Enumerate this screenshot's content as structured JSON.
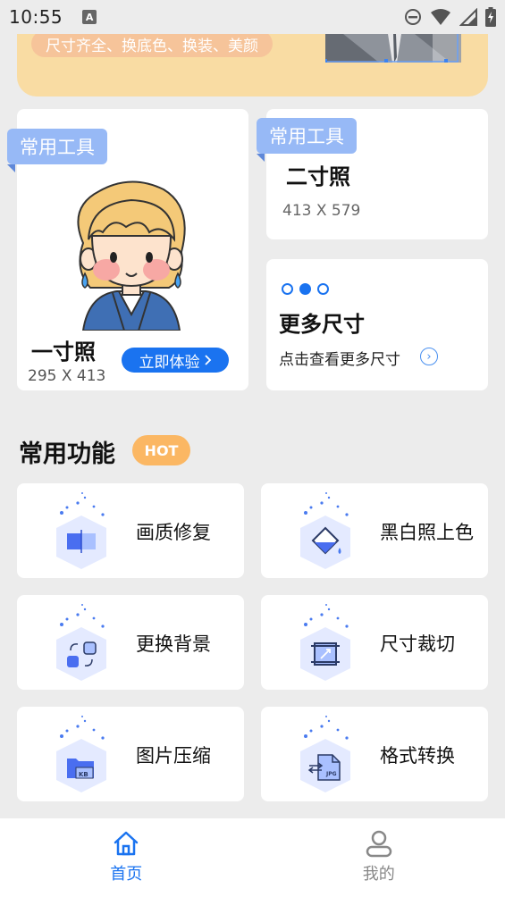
{
  "status_bar": {
    "time": "10:55",
    "notification_badge": "A"
  },
  "banner": {
    "pill_text": "尺寸齐全、换底色、换装、美颜"
  },
  "cards": {
    "one_inch": {
      "tag": "常用工具",
      "name": "一寸照",
      "size": "295 X 413",
      "button": "立即体验"
    },
    "two_inch": {
      "tag": "常用工具",
      "name": "二寸照",
      "size": "413 X 579"
    },
    "more": {
      "title": "更多尺寸",
      "subtitle": "点击查看更多尺寸"
    }
  },
  "section": {
    "title": "常用功能",
    "badge": "HOT"
  },
  "features": [
    {
      "label": "画质修复",
      "icon": "image-repair-icon"
    },
    {
      "label": "黑白照上色",
      "icon": "colorize-icon"
    },
    {
      "label": "更换背景",
      "icon": "background-swap-icon"
    },
    {
      "label": "尺寸裁切",
      "icon": "crop-icon"
    },
    {
      "label": "图片压缩",
      "icon": "compress-icon"
    },
    {
      "label": "格式转换",
      "icon": "format-convert-icon"
    }
  ],
  "icon_labels": {
    "compress": "KB",
    "convert": "JPG"
  },
  "bottom_nav": [
    {
      "label": "首页",
      "active": true
    },
    {
      "label": "我的",
      "active": false
    }
  ],
  "colors": {
    "accent": "#1a73f0",
    "tag": "#97b9f6",
    "hot": "#fbb763",
    "banner": "#f9dca3"
  }
}
